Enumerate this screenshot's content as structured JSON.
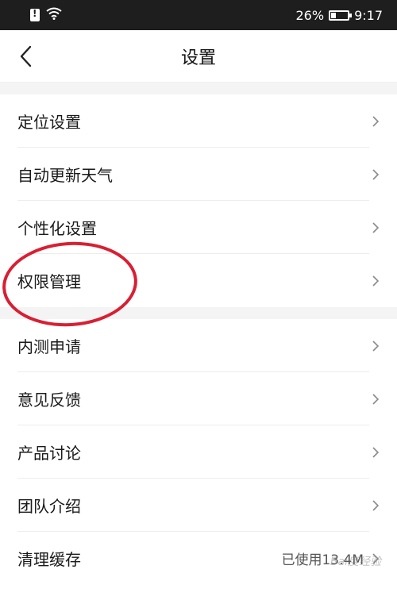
{
  "status_bar": {
    "battery_percent": "26%",
    "time": "9:17"
  },
  "nav": {
    "title": "设置"
  },
  "groups": [
    {
      "items": [
        {
          "label": "定位设置"
        },
        {
          "label": "自动更新天气"
        },
        {
          "label": "个性化设置"
        },
        {
          "label": "权限管理"
        }
      ]
    },
    {
      "items": [
        {
          "label": "内测申请"
        },
        {
          "label": "意见反馈"
        },
        {
          "label": "产品讨论"
        },
        {
          "label": "团队介绍"
        },
        {
          "label": "清理缓存",
          "value": "已使用13.4M"
        }
      ]
    }
  ],
  "watermark": "Bai度经验",
  "colors": {
    "status_bar_bg": "#1e1e1e",
    "highlight": "#d81f33",
    "group_gap": "#f4f4f4"
  }
}
